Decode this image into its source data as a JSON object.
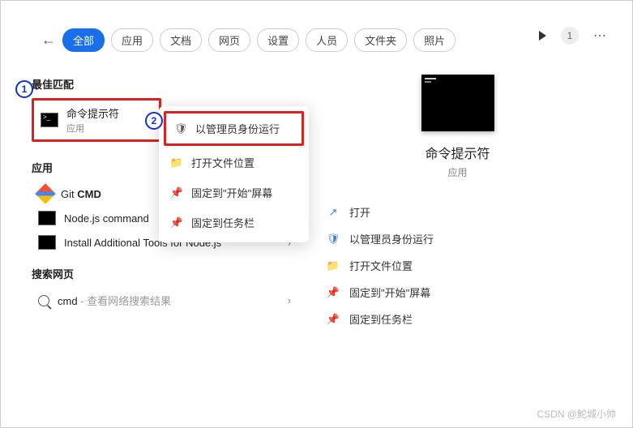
{
  "tabs": {
    "all": "全部",
    "apps": "应用",
    "docs": "文档",
    "web": "网页",
    "settings": "设置",
    "people": "人员",
    "folders": "文件夹",
    "photos": "照片"
  },
  "top": {
    "badge": "1"
  },
  "sections": {
    "best": "最佳匹配",
    "apps": "应用",
    "web": "搜索网页"
  },
  "best": {
    "name": "命令提示符",
    "type": "应用"
  },
  "apps": {
    "git": "Git CMD",
    "node": "Node.js command",
    "install": "Install Additional Tools for Node.js"
  },
  "web": {
    "cmd": "cmd",
    "hint": " - 查看网络搜索结果"
  },
  "ctx": {
    "admin": "以管理员身份运行",
    "loc": "打开文件位置",
    "pinstart": "固定到\"开始\"屏幕",
    "pintask": "固定到任务栏"
  },
  "preview": {
    "title": "命令提示符",
    "type": "应用"
  },
  "actions": {
    "open": "打开",
    "admin": "以管理员身份运行",
    "loc": "打开文件位置",
    "pinstart": "固定到\"开始\"屏幕",
    "pintask": "固定到任务栏"
  },
  "watermark": "CSDN @鮀城小帅",
  "annot": {
    "one": "1",
    "two": "2"
  }
}
